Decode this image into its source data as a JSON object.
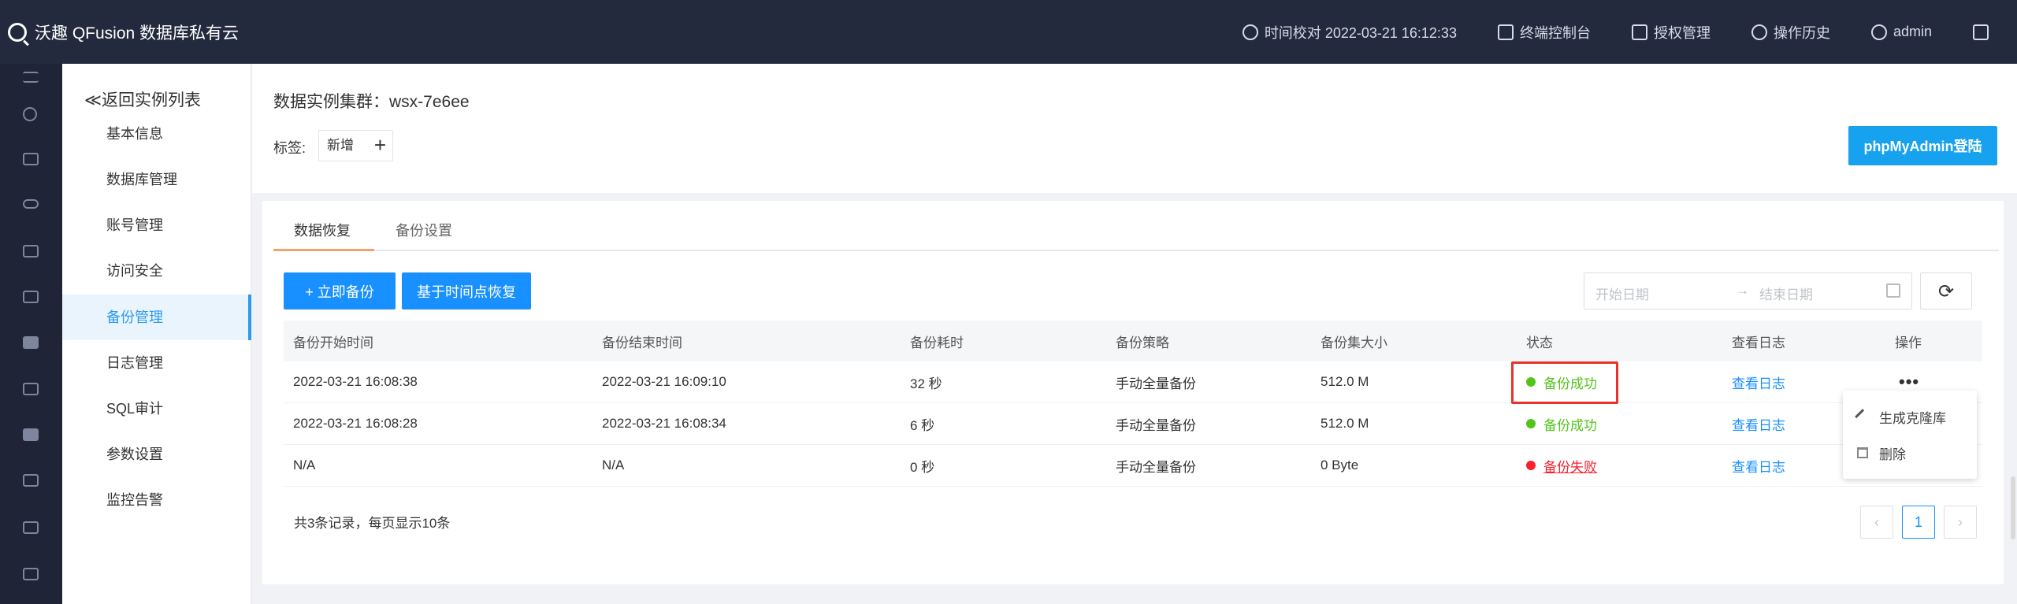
{
  "topbar": {
    "brand": "沃趣 QFusion 数据库私有云",
    "time_sync": "时间校对 2022-03-21 16:12:33",
    "terminal": "终端控制台",
    "license": "授权管理",
    "history": "操作历史",
    "user": "admin"
  },
  "sidebar": {
    "back": "≪返回实例列表",
    "items": [
      "基本信息",
      "数据库管理",
      "账号管理",
      "访问安全",
      "备份管理",
      "日志管理",
      "SQL审计",
      "参数设置",
      "监控告警"
    ],
    "active_index": 4
  },
  "header": {
    "cluster_title": "数据实例集群：wsx-7e6ee",
    "tag_label": "标签:",
    "tag_new": "新增",
    "tag_plus": "+",
    "pma_button": "phpMyAdmin登陆"
  },
  "tabs": {
    "restore": "数据恢复",
    "backup_settings": "备份设置"
  },
  "toolbar": {
    "backup_now": "+ 立即备份",
    "pitr": "基于时间点恢复",
    "start_placeholder": "开始日期",
    "arrow": "→",
    "end_placeholder": "结束日期",
    "refresh": "⟳"
  },
  "table": {
    "headers": [
      "备份开始时间",
      "备份结束时间",
      "备份耗时",
      "备份策略",
      "备份集大小",
      "状态",
      "查看日志",
      "操作"
    ],
    "rows": [
      {
        "start": "2022-03-21 16:08:38",
        "end": "2022-03-21 16:09:10",
        "duration": "32 秒",
        "policy": "手动全量备份",
        "size": "512.0 M",
        "status": "备份成功",
        "log": "查看日志",
        "op": "•••"
      },
      {
        "start": "2022-03-21 16:08:28",
        "end": "2022-03-21 16:08:34",
        "duration": "6 秒",
        "policy": "手动全量备份",
        "size": "512.0 M",
        "status": "备份成功",
        "log": "查看日志",
        "op": ""
      },
      {
        "start": "N/A",
        "end": "N/A",
        "duration": "0 秒",
        "policy": "手动全量备份",
        "size": "0 Byte",
        "status": "备份失败",
        "log": "查看日志",
        "op": ""
      }
    ]
  },
  "dropdown": {
    "clone": "生成克隆库",
    "delete": "删除"
  },
  "footer": {
    "summary": "共3条记录，每页显示10条",
    "prev": "‹",
    "page": "1",
    "next": "›"
  },
  "colors": {
    "topbar": "#242a3d",
    "primary": "#1890ff",
    "success": "#52c41a",
    "fail": "#f5222d",
    "highlight": "#e8322a"
  }
}
